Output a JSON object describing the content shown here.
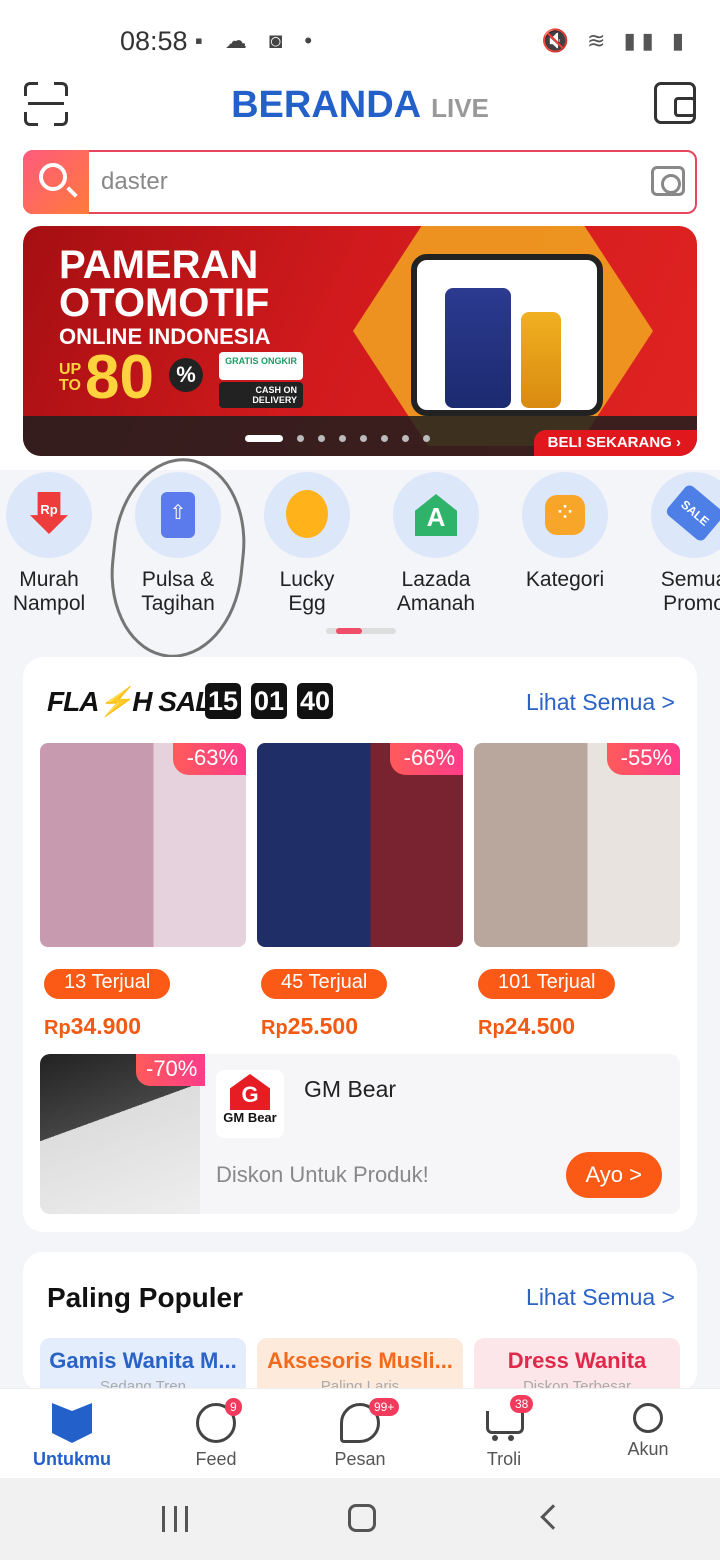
{
  "status_bar": {
    "time": "08:58",
    "left_icons": "▪ ☁ ◙ •",
    "right_icons": "🔇 ≋ ▮▮ ▮"
  },
  "header": {
    "title": "BERANDA",
    "live_label": "LIVE"
  },
  "search": {
    "value": "daster"
  },
  "banner": {
    "line1": "PAMERAN",
    "line2": "OTOMOTIF",
    "line3": "ONLINE INDONESIA",
    "upto": "UP TO",
    "discount": "80",
    "percent": "%",
    "gratis": "GRATIS ONGKIR",
    "cod": "CASH ON DELIVERY",
    "cta": "BELI SEKARANG ›",
    "slides": 8,
    "active_slide": 0
  },
  "categories": [
    {
      "line1": "Murah",
      "line2": "Nampol",
      "icon": "rp-arrow-icon"
    },
    {
      "line1": "Pulsa &",
      "line2": "Tagihan",
      "icon": "phone-icon"
    },
    {
      "line1": "Lucky",
      "line2": "Egg",
      "icon": "egg-icon"
    },
    {
      "line1": "Lazada",
      "line2": "Amanah",
      "icon": "mosque-icon"
    },
    {
      "line1": "Kategori",
      "line2": "",
      "icon": "grid-icon"
    },
    {
      "line1": "Semua",
      "line2": "Promo",
      "icon": "sale-tag-icon"
    }
  ],
  "flash_sale": {
    "title": "FLA⚡H SALE",
    "timer": [
      "15",
      "01",
      "40"
    ],
    "see_all": "Lihat Semua >",
    "products": [
      {
        "discount": "-63%",
        "sold": "13 Terjual",
        "currency": "Rp",
        "price": "34.900",
        "colors": [
          "#c89ab0",
          "#e6d2dc"
        ]
      },
      {
        "discount": "-66%",
        "sold": "45 Terjual",
        "currency": "Rp",
        "price": "25.500",
        "colors": [
          "#1f2e66",
          "#7a2330"
        ]
      },
      {
        "discount": "-55%",
        "sold": "101 Terjual",
        "currency": "Rp",
        "price": "24.500",
        "colors": [
          "#b9a79d",
          "#e9e3e0"
        ]
      }
    ],
    "promo": {
      "discount": "-70%",
      "logo_text": "GM Bear",
      "logo_letter": "G",
      "store": "GM Bear",
      "description": "Diskon Untuk  Produk!",
      "cta": "Ayo >"
    }
  },
  "populer": {
    "title": "Paling Populer",
    "see_all": "Lihat Semua >",
    "items": [
      {
        "label": "Gamis Wanita M...",
        "sub": "Sedang Tren",
        "color": "#2a62c6",
        "bg": "#e3edfc"
      },
      {
        "label": "Aksesoris Musli...",
        "sub": "Paling Laris",
        "color": "#f26b1d",
        "bg": "#fdeadb"
      },
      {
        "label": "Dress Wanita",
        "sub": "Diskon Terbesar",
        "color": "#e0294a",
        "bg": "#fde6ea"
      }
    ]
  },
  "tabbar": [
    {
      "label": "Untukmu",
      "icon": "home-icon",
      "badge": ""
    },
    {
      "label": "Feed",
      "icon": "feed-icon",
      "badge": "9"
    },
    {
      "label": "Pesan",
      "icon": "chat-icon",
      "badge": "99+"
    },
    {
      "label": "Troli",
      "icon": "cart-icon",
      "badge": "38"
    },
    {
      "label": "Akun",
      "icon": "user-icon",
      "badge": ""
    }
  ]
}
